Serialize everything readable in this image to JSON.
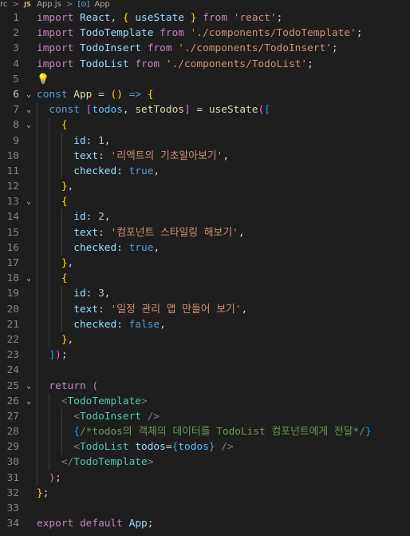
{
  "breadcrumb": {
    "folder": "rc",
    "separator": ">",
    "file_badge": "JS",
    "file": "App.js",
    "symbol_icon": "[⊙]",
    "symbol": "App"
  },
  "editor": {
    "language": "javascript",
    "active_line": 6,
    "lines": [
      {
        "n": "1",
        "fold": "",
        "tokens": [
          [
            "kw",
            "import"
          ],
          [
            "p",
            " "
          ],
          [
            "var",
            "React"
          ],
          [
            "p",
            ", "
          ],
          [
            "b1",
            "{"
          ],
          [
            "p",
            " "
          ],
          [
            "var",
            "useState"
          ],
          [
            "p",
            " "
          ],
          [
            "b1",
            "}"
          ],
          [
            "p",
            " "
          ],
          [
            "kw",
            "from"
          ],
          [
            "p",
            " "
          ],
          [
            "str",
            "'react'"
          ],
          [
            "p",
            ";"
          ]
        ]
      },
      {
        "n": "2",
        "fold": "",
        "tokens": [
          [
            "kw",
            "import"
          ],
          [
            "p",
            " "
          ],
          [
            "var",
            "TodoTemplate"
          ],
          [
            "p",
            " "
          ],
          [
            "kw",
            "from"
          ],
          [
            "p",
            " "
          ],
          [
            "str",
            "'./components/TodoTemplate'"
          ],
          [
            "p",
            ";"
          ]
        ]
      },
      {
        "n": "3",
        "fold": "",
        "tokens": [
          [
            "kw",
            "import"
          ],
          [
            "p",
            " "
          ],
          [
            "var",
            "TodoInsert"
          ],
          [
            "p",
            " "
          ],
          [
            "kw",
            "from"
          ],
          [
            "p",
            " "
          ],
          [
            "str",
            "'./components/TodoInsert'"
          ],
          [
            "p",
            ";"
          ]
        ]
      },
      {
        "n": "4",
        "fold": "",
        "tokens": [
          [
            "kw",
            "import"
          ],
          [
            "p",
            " "
          ],
          [
            "var",
            "TodoList"
          ],
          [
            "p",
            " "
          ],
          [
            "kw",
            "from"
          ],
          [
            "p",
            " "
          ],
          [
            "str",
            "'./components/TodoList'"
          ],
          [
            "p",
            ";"
          ]
        ]
      },
      {
        "n": "5",
        "fold": "",
        "tokens": [
          [
            "bulb",
            "💡"
          ]
        ]
      },
      {
        "n": "6",
        "fold": "⌄",
        "tokens": [
          [
            "bl",
            "const"
          ],
          [
            "p",
            " "
          ],
          [
            "fn",
            "App"
          ],
          [
            "p",
            " = "
          ],
          [
            "b1",
            "()"
          ],
          [
            "p",
            " "
          ],
          [
            "bl",
            "=>"
          ],
          [
            "p",
            " "
          ],
          [
            "b1",
            "{"
          ]
        ]
      },
      {
        "n": "7",
        "fold": "⌄",
        "tokens": [
          [
            "p",
            "  "
          ],
          [
            "bl",
            "const"
          ],
          [
            "p",
            " "
          ],
          [
            "b2",
            "["
          ],
          [
            "cst",
            "todos"
          ],
          [
            "p",
            ", "
          ],
          [
            "fn",
            "setTodos"
          ],
          [
            "b2",
            "]"
          ],
          [
            "p",
            " = "
          ],
          [
            "fn",
            "useState"
          ],
          [
            "b2",
            "("
          ],
          [
            "b3",
            "["
          ]
        ]
      },
      {
        "n": "8",
        "fold": "⌄",
        "tokens": [
          [
            "p",
            "    "
          ],
          [
            "b1",
            "{"
          ]
        ]
      },
      {
        "n": "9",
        "fold": "",
        "tokens": [
          [
            "p",
            "      "
          ],
          [
            "var",
            "id"
          ],
          [
            "p",
            ": "
          ],
          [
            "num",
            "1"
          ],
          [
            "p",
            ","
          ]
        ]
      },
      {
        "n": "10",
        "fold": "",
        "tokens": [
          [
            "p",
            "      "
          ],
          [
            "var",
            "text"
          ],
          [
            "p",
            ": "
          ],
          [
            "str",
            "'리액트의 기초알아보기'"
          ],
          [
            "p",
            ","
          ]
        ]
      },
      {
        "n": "11",
        "fold": "",
        "tokens": [
          [
            "p",
            "      "
          ],
          [
            "var",
            "checked"
          ],
          [
            "p",
            ": "
          ],
          [
            "bl",
            "true"
          ],
          [
            "p",
            ","
          ]
        ]
      },
      {
        "n": "12",
        "fold": "",
        "tokens": [
          [
            "p",
            "    "
          ],
          [
            "b1",
            "}"
          ],
          [
            "p",
            ","
          ]
        ]
      },
      {
        "n": "13",
        "fold": "⌄",
        "tokens": [
          [
            "p",
            "    "
          ],
          [
            "b1",
            "{"
          ]
        ]
      },
      {
        "n": "14",
        "fold": "",
        "tokens": [
          [
            "p",
            "      "
          ],
          [
            "var",
            "id"
          ],
          [
            "p",
            ": "
          ],
          [
            "num",
            "2"
          ],
          [
            "p",
            ","
          ]
        ]
      },
      {
        "n": "15",
        "fold": "",
        "tokens": [
          [
            "p",
            "      "
          ],
          [
            "var",
            "text"
          ],
          [
            "p",
            ": "
          ],
          [
            "str",
            "'컴포넌트 스타일링 해보기'"
          ],
          [
            "p",
            ","
          ]
        ]
      },
      {
        "n": "16",
        "fold": "",
        "tokens": [
          [
            "p",
            "      "
          ],
          [
            "var",
            "checked"
          ],
          [
            "p",
            ": "
          ],
          [
            "bl",
            "true"
          ],
          [
            "p",
            ","
          ]
        ]
      },
      {
        "n": "17",
        "fold": "",
        "tokens": [
          [
            "p",
            "    "
          ],
          [
            "b1",
            "}"
          ],
          [
            "p",
            ","
          ]
        ]
      },
      {
        "n": "18",
        "fold": "⌄",
        "tokens": [
          [
            "p",
            "    "
          ],
          [
            "b1",
            "{"
          ]
        ]
      },
      {
        "n": "19",
        "fold": "",
        "tokens": [
          [
            "p",
            "      "
          ],
          [
            "var",
            "id"
          ],
          [
            "p",
            ": "
          ],
          [
            "num",
            "3"
          ],
          [
            "p",
            ","
          ]
        ]
      },
      {
        "n": "20",
        "fold": "",
        "tokens": [
          [
            "p",
            "      "
          ],
          [
            "var",
            "text"
          ],
          [
            "p",
            ": "
          ],
          [
            "str",
            "'일정 관리 앱 만들어 보기'"
          ],
          [
            "p",
            ","
          ]
        ]
      },
      {
        "n": "21",
        "fold": "",
        "tokens": [
          [
            "p",
            "      "
          ],
          [
            "var",
            "checked"
          ],
          [
            "p",
            ": "
          ],
          [
            "bl",
            "false"
          ],
          [
            "p",
            ","
          ]
        ]
      },
      {
        "n": "22",
        "fold": "",
        "tokens": [
          [
            "p",
            "    "
          ],
          [
            "b1",
            "}"
          ],
          [
            "p",
            ","
          ]
        ]
      },
      {
        "n": "23",
        "fold": "",
        "tokens": [
          [
            "p",
            "  "
          ],
          [
            "b3",
            "]"
          ],
          [
            "b2",
            ")"
          ],
          [
            "p",
            ";"
          ]
        ]
      },
      {
        "n": "24",
        "fold": "",
        "tokens": []
      },
      {
        "n": "25",
        "fold": "⌄",
        "tokens": [
          [
            "p",
            "  "
          ],
          [
            "kw",
            "return"
          ],
          [
            "p",
            " "
          ],
          [
            "b2",
            "("
          ]
        ]
      },
      {
        "n": "26",
        "fold": "⌄",
        "tokens": [
          [
            "p",
            "    "
          ],
          [
            "tb",
            "<"
          ],
          [
            "tag",
            "TodoTemplate"
          ],
          [
            "tb",
            ">"
          ]
        ]
      },
      {
        "n": "27",
        "fold": "",
        "tokens": [
          [
            "p",
            "      "
          ],
          [
            "tb",
            "<"
          ],
          [
            "tag",
            "TodoInsert"
          ],
          [
            "p",
            " "
          ],
          [
            "tb",
            "/>"
          ]
        ]
      },
      {
        "n": "28",
        "fold": "",
        "tokens": [
          [
            "p",
            "      "
          ],
          [
            "b3",
            "{"
          ],
          [
            "cm",
            "/*todos의 객체의 데이터를 TodoList 컴포넌트에게 전달*/"
          ],
          [
            "b3",
            "}"
          ]
        ]
      },
      {
        "n": "29",
        "fold": "",
        "tokens": [
          [
            "p",
            "      "
          ],
          [
            "tb",
            "<"
          ],
          [
            "tag",
            "TodoList"
          ],
          [
            "p",
            " "
          ],
          [
            "var",
            "todos"
          ],
          [
            "p",
            "="
          ],
          [
            "bl",
            "{"
          ],
          [
            "cst",
            "todos"
          ],
          [
            "bl",
            "}"
          ],
          [
            "p",
            " "
          ],
          [
            "tb",
            "/>"
          ]
        ]
      },
      {
        "n": "30",
        "fold": "",
        "tokens": [
          [
            "p",
            "    "
          ],
          [
            "tb",
            "</"
          ],
          [
            "tag",
            "TodoTemplate"
          ],
          [
            "tb",
            ">"
          ]
        ]
      },
      {
        "n": "31",
        "fold": "",
        "tokens": [
          [
            "p",
            "  "
          ],
          [
            "b2",
            ")"
          ],
          [
            "p",
            ";"
          ]
        ]
      },
      {
        "n": "32",
        "fold": "",
        "tokens": [
          [
            "b1",
            "}"
          ],
          [
            "p",
            ";"
          ]
        ]
      },
      {
        "n": "33",
        "fold": "",
        "tokens": []
      },
      {
        "n": "34",
        "fold": "",
        "tokens": [
          [
            "kw",
            "export"
          ],
          [
            "p",
            " "
          ],
          [
            "kw",
            "default"
          ],
          [
            "p",
            " "
          ],
          [
            "var",
            "App"
          ],
          [
            "p",
            ";"
          ]
        ]
      }
    ]
  }
}
